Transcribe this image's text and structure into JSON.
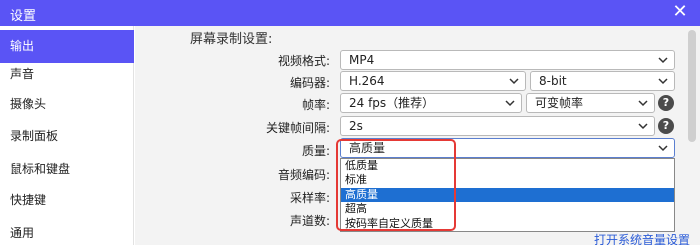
{
  "window": {
    "title": "设置",
    "close_glyph": "✕"
  },
  "sidebar": {
    "items": [
      {
        "label": "输出",
        "active": true
      },
      {
        "label": "声音"
      },
      {
        "label": "摄像头"
      },
      {
        "label": "录制面板"
      },
      {
        "label": "鼠标和键盘"
      },
      {
        "label": "快捷键"
      },
      {
        "label": "通用"
      }
    ]
  },
  "main": {
    "section_title": "屏幕录制设置:",
    "video_format": {
      "label": "视频格式:",
      "value": "MP4"
    },
    "encoder": {
      "label": "编码器:",
      "value": "H.264",
      "bit_depth": "8-bit"
    },
    "frame_rate": {
      "label": "帧率:",
      "value": "24 fps（推荐）",
      "mode": "可变帧率",
      "help": "?"
    },
    "keyframe_interval": {
      "label": "关键帧间隔:",
      "value": "2s",
      "help": "?"
    },
    "quality": {
      "label": "质量:",
      "value": "高质量",
      "options": [
        "低质量",
        "标准",
        "高质量",
        "超高",
        "按码率自定义质量"
      ],
      "selected_index": 2
    },
    "audio_encoder": {
      "label": "音频编码:"
    },
    "sample_rate": {
      "label": "采样率:"
    },
    "channels": {
      "label": "声道数:"
    },
    "system_volume_link": "打开系统音量设置"
  },
  "colors": {
    "accent": "#5a54f5",
    "highlight_border": "#e53935",
    "selected_option": "#1e6fd2",
    "link": "#2a5bd7"
  }
}
